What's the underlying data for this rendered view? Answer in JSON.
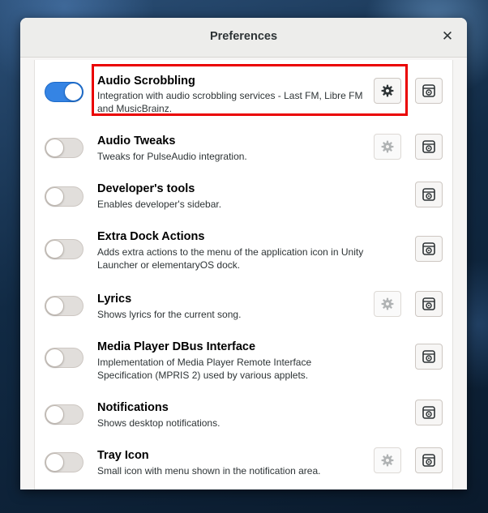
{
  "window": {
    "title": "Preferences",
    "close_glyph": "✕"
  },
  "colors": {
    "switch_on": "#3584e4",
    "highlight": "#ea0000"
  },
  "plugins": [
    {
      "name": "Audio Scrobbling",
      "description": "Integration with audio scrobbling services - Last FM, Libre FM and MusicBrainz.",
      "enabled": true,
      "settings": "enabled"
    },
    {
      "name": "Audio Tweaks",
      "description": "Tweaks for PulseAudio integration.",
      "enabled": false,
      "settings": "disabled"
    },
    {
      "name": "Developer's tools",
      "description": "Enables developer's sidebar.",
      "enabled": false,
      "settings": "none"
    },
    {
      "name": "Extra Dock Actions",
      "description": "Adds extra actions to the menu of the application icon in Unity Launcher or elementaryOS dock.",
      "enabled": false,
      "settings": "none"
    },
    {
      "name": "Lyrics",
      "description": "Shows lyrics for the current song.",
      "enabled": false,
      "settings": "disabled"
    },
    {
      "name": "Media Player DBus Interface",
      "description": "Implementation of Media Player Remote Interface Specification (MPRIS 2) used by various applets.",
      "enabled": false,
      "settings": "none"
    },
    {
      "name": "Notifications",
      "description": "Shows desktop notifications.",
      "enabled": false,
      "settings": "none"
    },
    {
      "name": "Tray Icon",
      "description": "Small icon with menu shown in the notification area.",
      "enabled": false,
      "settings": "disabled"
    }
  ],
  "icons": {
    "settings": "gear-icon",
    "about": "about-icon"
  }
}
